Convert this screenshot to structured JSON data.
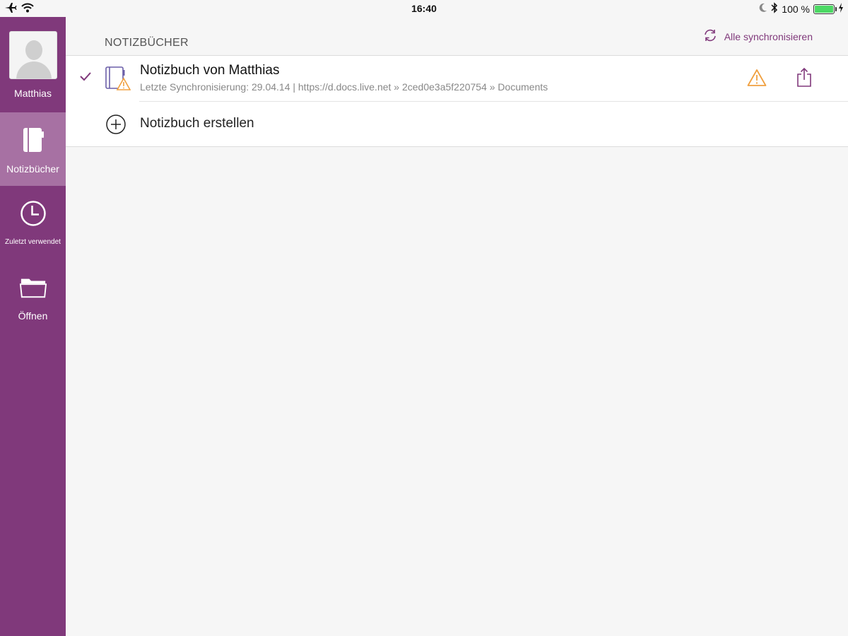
{
  "status_bar": {
    "time": "16:40",
    "battery_text": "100 %",
    "battery_level": 1.0,
    "icons": [
      "airplane-icon",
      "wifi-icon",
      "moon-icon",
      "bluetooth-icon",
      "battery-icon",
      "charging-icon"
    ]
  },
  "sidebar": {
    "profile_name": "Matthias",
    "items": [
      {
        "label": "Notizbücher",
        "icon": "notebook-icon",
        "active": true
      },
      {
        "label": "Zuletzt verwendet",
        "icon": "clock-icon",
        "active": false
      },
      {
        "label": "Öffnen",
        "icon": "folder-icon",
        "active": false
      }
    ]
  },
  "main": {
    "section_title": "NOTIZBÜCHER",
    "sync_all_label": "Alle synchronisieren",
    "notebooks": [
      {
        "title": "Notizbuch von Matthias",
        "subtitle": "Letzte Synchronisierung: 29.04.14 | https://d.docs.live.net » 2ced0e3a5f220754 » Documents",
        "selected": true,
        "has_warning": true
      }
    ],
    "create_label": "Notizbuch erstellen"
  },
  "colors": {
    "accent": "#80397b",
    "sidebar_active": "#a771a3",
    "warning": "#f0a040",
    "battery": "#4cd964"
  }
}
